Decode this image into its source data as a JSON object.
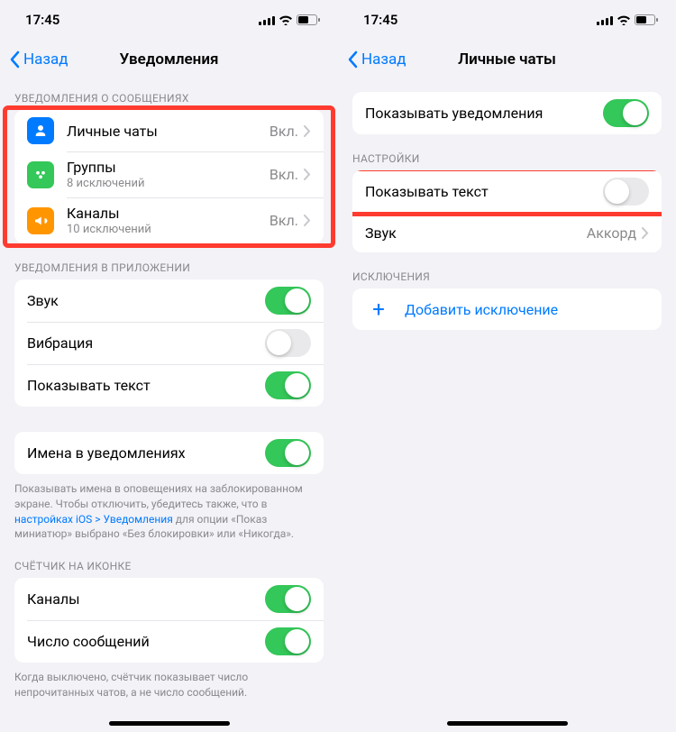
{
  "status": {
    "time": "17:45"
  },
  "left": {
    "back": "Назад",
    "title": "Уведомления",
    "sec1_header": "УВЕДОМЛЕНИЯ О СООБЩЕНИЯХ",
    "sec1": [
      {
        "label": "Личные чаты",
        "sub": "",
        "value": "Вкл.",
        "icon": "person",
        "color": "#007aff"
      },
      {
        "label": "Группы",
        "sub": "8 исключений",
        "value": "Вкл.",
        "icon": "group",
        "color": "#34c759"
      },
      {
        "label": "Каналы",
        "sub": "10 исключений",
        "value": "Вкл.",
        "icon": "megaphone",
        "color": "#ff9500"
      }
    ],
    "sec2_header": "УВЕДОМЛЕНИЯ В ПРИЛОЖЕНИИ",
    "sec2": [
      {
        "label": "Звук",
        "on": true
      },
      {
        "label": "Вибрация",
        "on": false
      },
      {
        "label": "Показывать текст",
        "on": true
      }
    ],
    "sec3": {
      "label": "Имена в уведомлениях",
      "on": true
    },
    "sec3_footer_pre": "Показывать имена в оповещениях на заблокированном экране. Чтобы отключить, убедитесь также, что в ",
    "sec3_footer_link": "настройках iOS > Уведомления",
    "sec3_footer_post": " для опции «Показ миниатюр» выбрано «Без блокировки» или «Никогда».",
    "sec4_header": "СЧЁТЧИК НА ИКОНКЕ",
    "sec4": [
      {
        "label": "Каналы",
        "on": true
      },
      {
        "label": "Число сообщений",
        "on": true
      }
    ],
    "sec4_footer": "Когда выключено, счётчик показывает число непрочитанных чатов, а не число сообщений."
  },
  "right": {
    "back": "Назад",
    "title": "Личные чаты",
    "row_show_notif": {
      "label": "Показывать уведомления",
      "on": true
    },
    "sec2_header": "НАСТРОЙКИ",
    "row_text": {
      "label": "Показывать текст",
      "on": false
    },
    "row_sound": {
      "label": "Звук",
      "value": "Аккорд"
    },
    "sec3_header": "ИСКЛЮЧЕНИЯ",
    "row_add": "Добавить исключение"
  }
}
